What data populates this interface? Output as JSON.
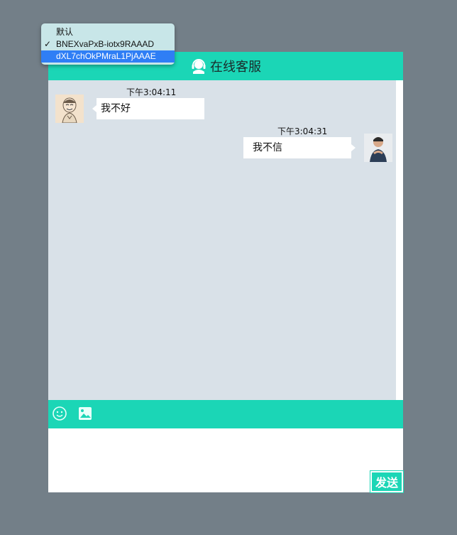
{
  "header": {
    "title": "在线客服",
    "icon": "headset-icon"
  },
  "dropdown": {
    "options": [
      {
        "label": "默认",
        "checked": false,
        "highlighted": false
      },
      {
        "label": "BNEXvaPxB-iotx9RAAAD",
        "checked": true,
        "highlighted": false
      },
      {
        "label": "dXL7chOkPMraL1PjAAAE",
        "checked": false,
        "highlighted": true
      }
    ],
    "check_mark": "✓"
  },
  "messages": [
    {
      "side": "left",
      "time": "下午3:04:11",
      "text": "我不好",
      "avatar": "cartoon-avatar"
    },
    {
      "side": "right",
      "time": "下午3:04:31",
      "text": "我不信",
      "avatar": "user-photo-avatar"
    }
  ],
  "toolbar": {
    "emoji_icon": "smiley-icon",
    "image_icon": "image-icon"
  },
  "input": {
    "value": "",
    "placeholder": ""
  },
  "send_button": {
    "label": "发送"
  },
  "colors": {
    "accent": "#1bd6b6",
    "background": "#737f88",
    "chat_bg": "#d9e1e8",
    "highlight": "#2f7ef5"
  }
}
